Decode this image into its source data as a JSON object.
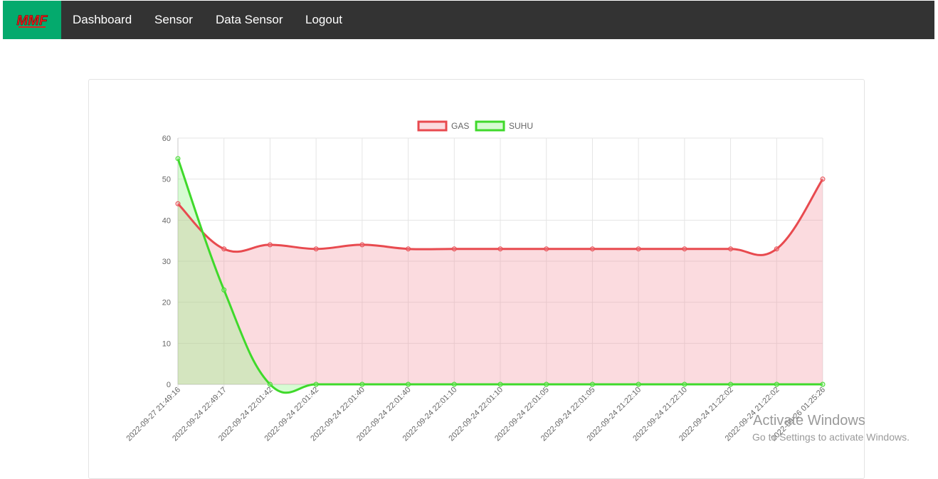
{
  "nav": {
    "logo_text": "MMF",
    "items": [
      "Dashboard",
      "Sensor",
      "Data Sensor",
      "Logout"
    ],
    "bg": "#333333",
    "logo_bg": "#04AA6D"
  },
  "chart_data": {
    "type": "line",
    "categories": [
      "2022-09-27 21:49:16",
      "2022-09-24 22:49:17",
      "2022-09-24 22:01:42",
      "2022-09-24 22:01:42",
      "2022-09-24 22:01:40",
      "2022-09-24 22:01:40",
      "2022-09-24 22:01:10",
      "2022-09-24 22:01:10",
      "2022-09-24 22:01:05",
      "2022-09-24 22:01:05",
      "2022-09-24 21:22:10",
      "2022-09-24 21:22:10",
      "2022-09-24 21:22:02",
      "2022-09-24 21:22:02",
      "2022-09-26 01:25:26"
    ],
    "series": [
      {
        "name": "GAS",
        "values": [
          44,
          33,
          34,
          33,
          34,
          33,
          33,
          33,
          33,
          33,
          33,
          33,
          33,
          33,
          50
        ],
        "color": "#e84a4f",
        "fill": "rgba(244,143,155,0.32)"
      },
      {
        "name": "SUHU",
        "values": [
          55,
          23,
          0,
          0,
          0,
          0,
          0,
          0,
          0,
          0,
          0,
          0,
          0,
          0,
          0
        ],
        "color": "#3fd92b",
        "fill": "rgba(150,245,140,0.38)"
      }
    ],
    "ylim": [
      0,
      60
    ],
    "yticks": [
      0,
      10,
      20,
      30,
      40,
      50,
      60
    ],
    "legend": "top",
    "grid": true
  },
  "watermark": {
    "line1": "Activate Windows",
    "line2": "Go to Settings to activate Windows."
  }
}
